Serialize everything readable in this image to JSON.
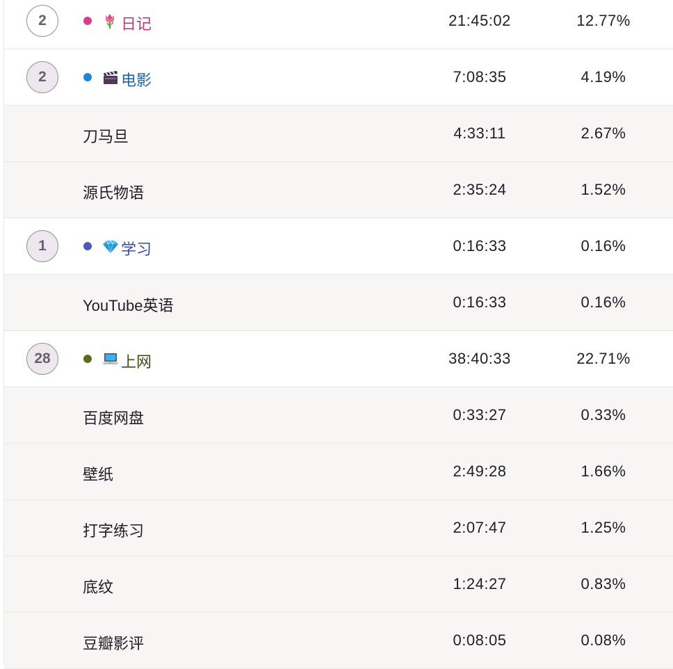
{
  "colors": {
    "diary": "#d8418a",
    "movie": "#1a86d6",
    "study": "#4a5cb6",
    "web": "#5a6b22",
    "diary_text": "#b33c7a",
    "movie_text": "#1d64a8",
    "study_text": "#3a4aa0",
    "web_text": "#3e4a18"
  },
  "rows": [
    {
      "kind": "category",
      "count": "2",
      "badge_shaded": false,
      "icon": "tulip-icon",
      "color": "diary",
      "name": "日记",
      "duration": "21:45:02",
      "percent": "12.77%"
    },
    {
      "kind": "category",
      "count": "2",
      "badge_shaded": true,
      "icon": "clapper-board-icon",
      "color": "movie",
      "name": "电影",
      "duration": "7:08:35",
      "percent": "4.19%"
    },
    {
      "kind": "item",
      "name": "刀马旦",
      "duration": "4:33:11",
      "percent": "2.67%"
    },
    {
      "kind": "item",
      "name": "源氏物语",
      "duration": "2:35:24",
      "percent": "1.52%"
    },
    {
      "kind": "category",
      "count": "1",
      "badge_shaded": true,
      "icon": "gem-icon",
      "color": "study",
      "name": "学习",
      "duration": "0:16:33",
      "percent": "0.16%"
    },
    {
      "kind": "item",
      "name": "YouTube英语",
      "duration": "0:16:33",
      "percent": "0.16%"
    },
    {
      "kind": "category",
      "count": "28",
      "badge_shaded": true,
      "icon": "laptop-icon",
      "color": "web",
      "name": "上网",
      "duration": "38:40:33",
      "percent": "22.71%"
    },
    {
      "kind": "item",
      "name": "百度网盘",
      "duration": "0:33:27",
      "percent": "0.33%"
    },
    {
      "kind": "item",
      "name": "壁纸",
      "duration": "2:49:28",
      "percent": "1.66%"
    },
    {
      "kind": "item",
      "name": "打字练习",
      "duration": "2:07:47",
      "percent": "1.25%"
    },
    {
      "kind": "item",
      "name": "底纹",
      "duration": "1:24:27",
      "percent": "0.83%"
    },
    {
      "kind": "item",
      "name": "豆瓣影评",
      "duration": "0:08:05",
      "percent": "0.08%"
    }
  ]
}
